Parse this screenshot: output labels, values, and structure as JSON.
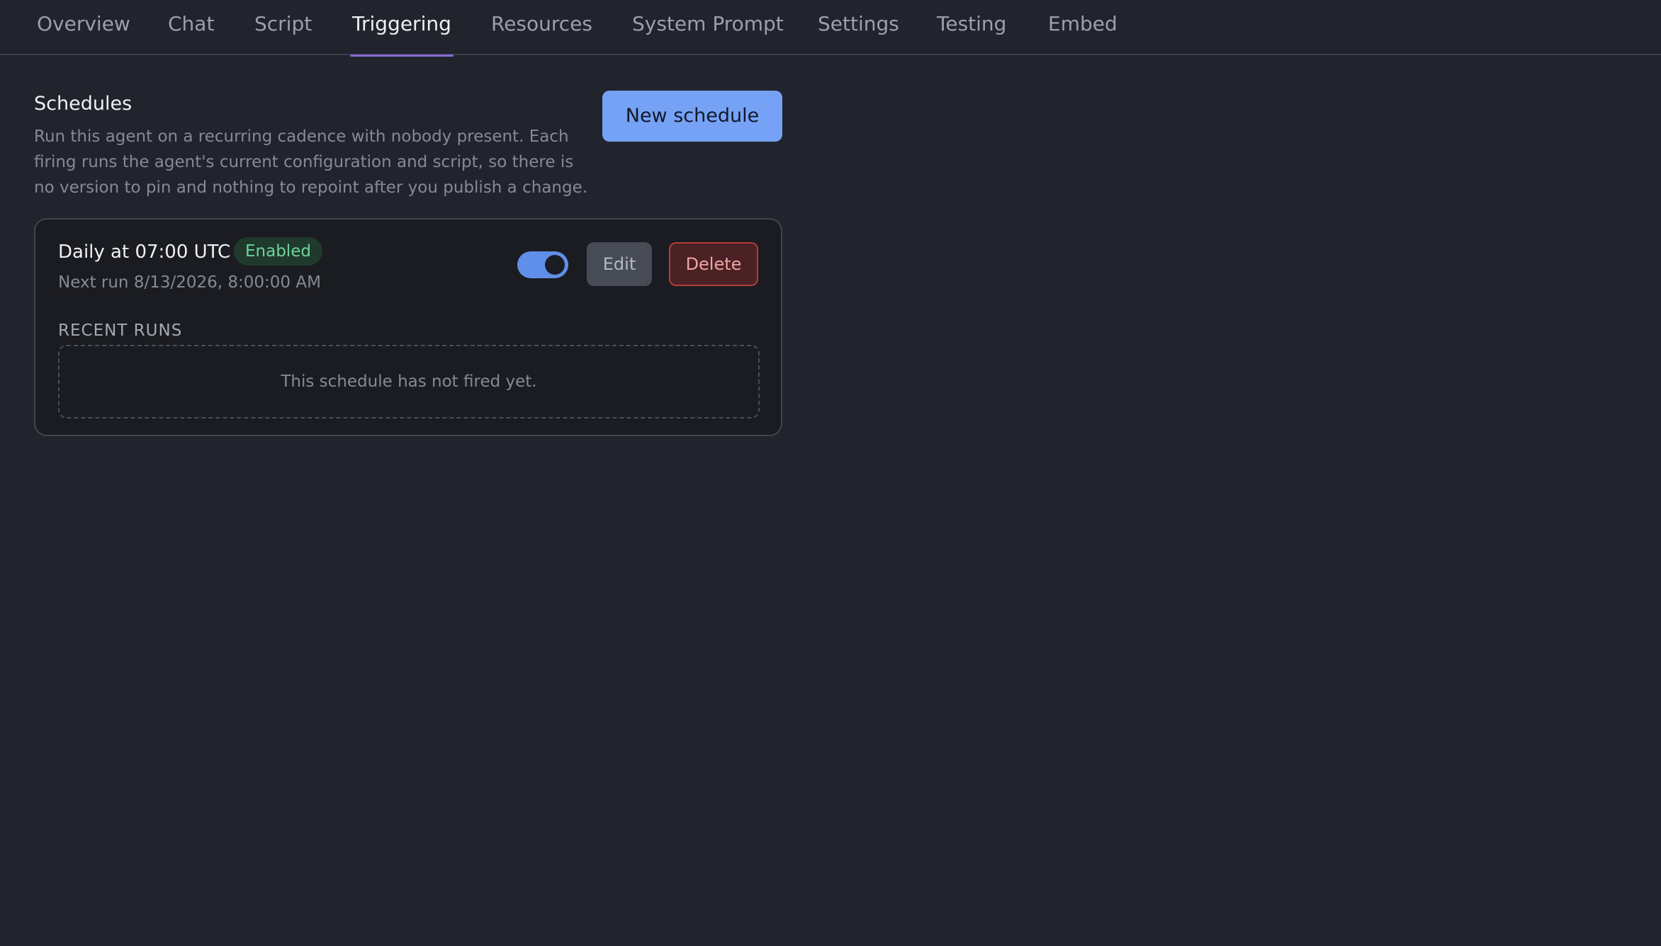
{
  "tabs": [
    {
      "label": "Overview"
    },
    {
      "label": "Chat"
    },
    {
      "label": "Script"
    },
    {
      "label": "Triggering",
      "active": true
    },
    {
      "label": "Resources"
    },
    {
      "label": "System Prompt"
    },
    {
      "label": "Settings"
    },
    {
      "label": "Testing"
    },
    {
      "label": "Embed"
    }
  ],
  "schedules": {
    "title": "Schedules",
    "description": "Run this agent on a recurring cadence with nobody present. Each firing runs the agent's current configuration and script, so there is no version to pin and nothing to repoint after you publish a change.",
    "new_button_label": "New schedule",
    "items": [
      {
        "name": "Daily at 07:00 UTC",
        "status": "Enabled",
        "next_run": "Next run 8/13/2026, 8:00:00 AM",
        "enabled": true,
        "edit_label": "Edit",
        "delete_label": "Delete",
        "recent_runs_label": "RECENT RUNS",
        "empty_message": "This schedule has not fired yet."
      }
    ]
  },
  "colors": {
    "background": "#21242d",
    "accent": "#75a2f4",
    "active_tab_underline": "#8a6ad6",
    "enabled_badge_bg": "#1f3a2c",
    "enabled_badge_text": "#6fd39c",
    "danger": "#b13e3e"
  },
  "icons": {
    "toggle": "toggle-switch-on"
  }
}
